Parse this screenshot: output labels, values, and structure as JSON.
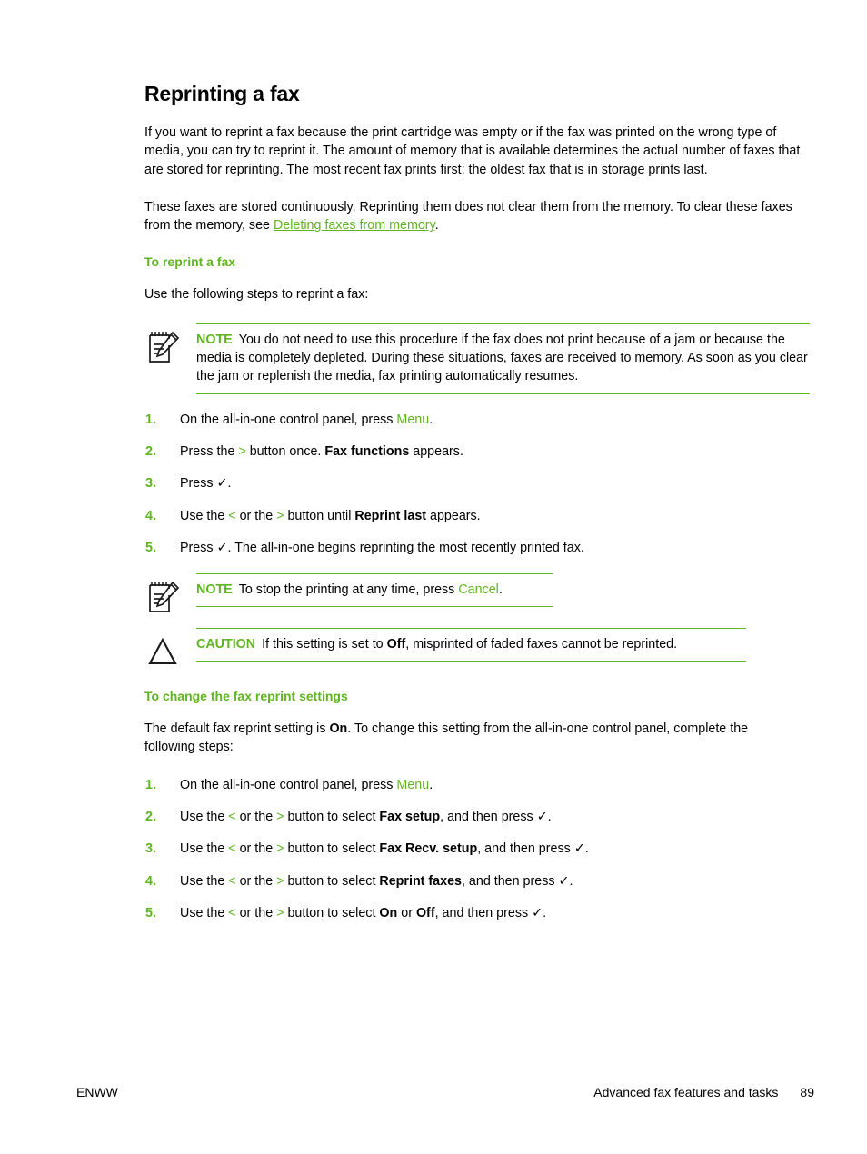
{
  "page": {
    "title": "Reprinting a fax",
    "intro_paragraph": "If you want to reprint a fax because the print cartridge was empty or if the fax was printed on the wrong type of media, you can try to reprint it. The amount of memory that is available determines the actual number of faxes that are stored for reprinting. The most recent fax prints first; the oldest fax that is in storage prints last.",
    "second_paragraph_before_link": "These faxes are stored continuously. Reprinting them does not clear them from the memory. To clear these faxes from the memory, see ",
    "second_paragraph_link": "Deleting faxes from memory",
    "second_paragraph_after_link": "."
  },
  "section_reprint": {
    "heading": "To reprint a fax",
    "lead_in": "Use the following steps to reprint a fax:",
    "note": {
      "label": "NOTE",
      "text": "You do not need to use this procedure if the fax does not print because of a jam or because the media is completely depleted. During these situations, faxes are received to memory. As soon as you clear the jam or replenish the media, fax printing automatically resumes.",
      "icon": "note-pencil-icon"
    },
    "steps": [
      {
        "number": "1.",
        "segments": [
          {
            "text": "On the all-in-one control panel, press ",
            "style": "plain"
          },
          {
            "text": "Menu",
            "style": "uicmd"
          },
          {
            "text": ".",
            "style": "plain"
          }
        ]
      },
      {
        "number": "2.",
        "segments": [
          {
            "text": "Press the ",
            "style": "plain"
          },
          {
            "text": ">",
            "style": "glyph"
          },
          {
            "text": " button once. ",
            "style": "plain"
          },
          {
            "text": "Fax functions",
            "style": "bold"
          },
          {
            "text": " appears.",
            "style": "plain"
          }
        ]
      },
      {
        "number": "3.",
        "segments": [
          {
            "text": "Press ",
            "style": "plain"
          },
          {
            "text": "✓",
            "style": "check"
          },
          {
            "text": ".",
            "style": "plain"
          }
        ]
      },
      {
        "number": "4.",
        "segments": [
          {
            "text": "Use the ",
            "style": "plain"
          },
          {
            "text": "<",
            "style": "glyph"
          },
          {
            "text": " or the ",
            "style": "plain"
          },
          {
            "text": ">",
            "style": "glyph"
          },
          {
            "text": " button until ",
            "style": "plain"
          },
          {
            "text": "Reprint last",
            "style": "bold"
          },
          {
            "text": " appears.",
            "style": "plain"
          }
        ]
      },
      {
        "number": "5.",
        "segments": [
          {
            "text": "Press ",
            "style": "plain"
          },
          {
            "text": "✓",
            "style": "check"
          },
          {
            "text": ". The all-in-one begins reprinting the most recently printed fax.",
            "style": "plain"
          }
        ]
      }
    ],
    "note2": {
      "label": "NOTE",
      "icon": "note-pencil-icon",
      "segments": [
        {
          "text": "To stop the printing at any time, press ",
          "style": "plain"
        },
        {
          "text": "Cancel",
          "style": "uicmd"
        },
        {
          "text": ".",
          "style": "plain"
        }
      ]
    },
    "caution": {
      "label": "CAUTION",
      "icon": "warning-triangle-icon",
      "segments": [
        {
          "text": "If this setting is set to ",
          "style": "plain"
        },
        {
          "text": "Off",
          "style": "bold"
        },
        {
          "text": ", misprinted of faded faxes cannot be reprinted.",
          "style": "plain"
        }
      ]
    }
  },
  "section_settings": {
    "heading": "To change the fax reprint settings",
    "lead_in_segments": [
      {
        "text": "The default fax reprint setting is ",
        "style": "plain"
      },
      {
        "text": "On",
        "style": "bold"
      },
      {
        "text": ". To change this setting from the all-in-one control panel, complete the following steps:",
        "style": "plain"
      }
    ],
    "steps": [
      {
        "number": "1.",
        "segments": [
          {
            "text": "On the all-in-one control panel, press ",
            "style": "plain"
          },
          {
            "text": "Menu",
            "style": "uicmd"
          },
          {
            "text": ".",
            "style": "plain"
          }
        ]
      },
      {
        "number": "2.",
        "segments": [
          {
            "text": "Use the ",
            "style": "plain"
          },
          {
            "text": "<",
            "style": "glyph"
          },
          {
            "text": " or the ",
            "style": "plain"
          },
          {
            "text": ">",
            "style": "glyph"
          },
          {
            "text": " button to select ",
            "style": "plain"
          },
          {
            "text": "Fax setup",
            "style": "bold"
          },
          {
            "text": ", and then press ",
            "style": "plain"
          },
          {
            "text": "✓",
            "style": "check"
          },
          {
            "text": ".",
            "style": "plain"
          }
        ]
      },
      {
        "number": "3.",
        "segments": [
          {
            "text": "Use the ",
            "style": "plain"
          },
          {
            "text": "<",
            "style": "glyph"
          },
          {
            "text": " or the ",
            "style": "plain"
          },
          {
            "text": ">",
            "style": "glyph"
          },
          {
            "text": " button to select ",
            "style": "plain"
          },
          {
            "text": "Fax Recv. setup",
            "style": "bold"
          },
          {
            "text": ", and then press ",
            "style": "plain"
          },
          {
            "text": "✓",
            "style": "check"
          },
          {
            "text": ".",
            "style": "plain"
          }
        ]
      },
      {
        "number": "4.",
        "segments": [
          {
            "text": "Use the ",
            "style": "plain"
          },
          {
            "text": "<",
            "style": "glyph"
          },
          {
            "text": " or the ",
            "style": "plain"
          },
          {
            "text": ">",
            "style": "glyph"
          },
          {
            "text": " button to select ",
            "style": "plain"
          },
          {
            "text": "Reprint faxes",
            "style": "bold"
          },
          {
            "text": ", and then press ",
            "style": "plain"
          },
          {
            "text": "✓",
            "style": "check"
          },
          {
            "text": ".",
            "style": "plain"
          }
        ]
      },
      {
        "number": "5.",
        "segments": [
          {
            "text": "Use the ",
            "style": "plain"
          },
          {
            "text": "<",
            "style": "glyph"
          },
          {
            "text": " or the ",
            "style": "plain"
          },
          {
            "text": ">",
            "style": "glyph"
          },
          {
            "text": " button to select ",
            "style": "plain"
          },
          {
            "text": "On",
            "style": "bold"
          },
          {
            "text": " or ",
            "style": "plain"
          },
          {
            "text": "Off",
            "style": "bold"
          },
          {
            "text": ", and then press ",
            "style": "plain"
          },
          {
            "text": "✓",
            "style": "check"
          },
          {
            "text": ".",
            "style": "plain"
          }
        ]
      }
    ]
  },
  "footer": {
    "left": "ENWW",
    "chapter": "Advanced fax features and tasks",
    "page_number": "89"
  },
  "colors": {
    "accent_green": "#5FB520",
    "text_black": "#000000",
    "background": "#ffffff"
  }
}
